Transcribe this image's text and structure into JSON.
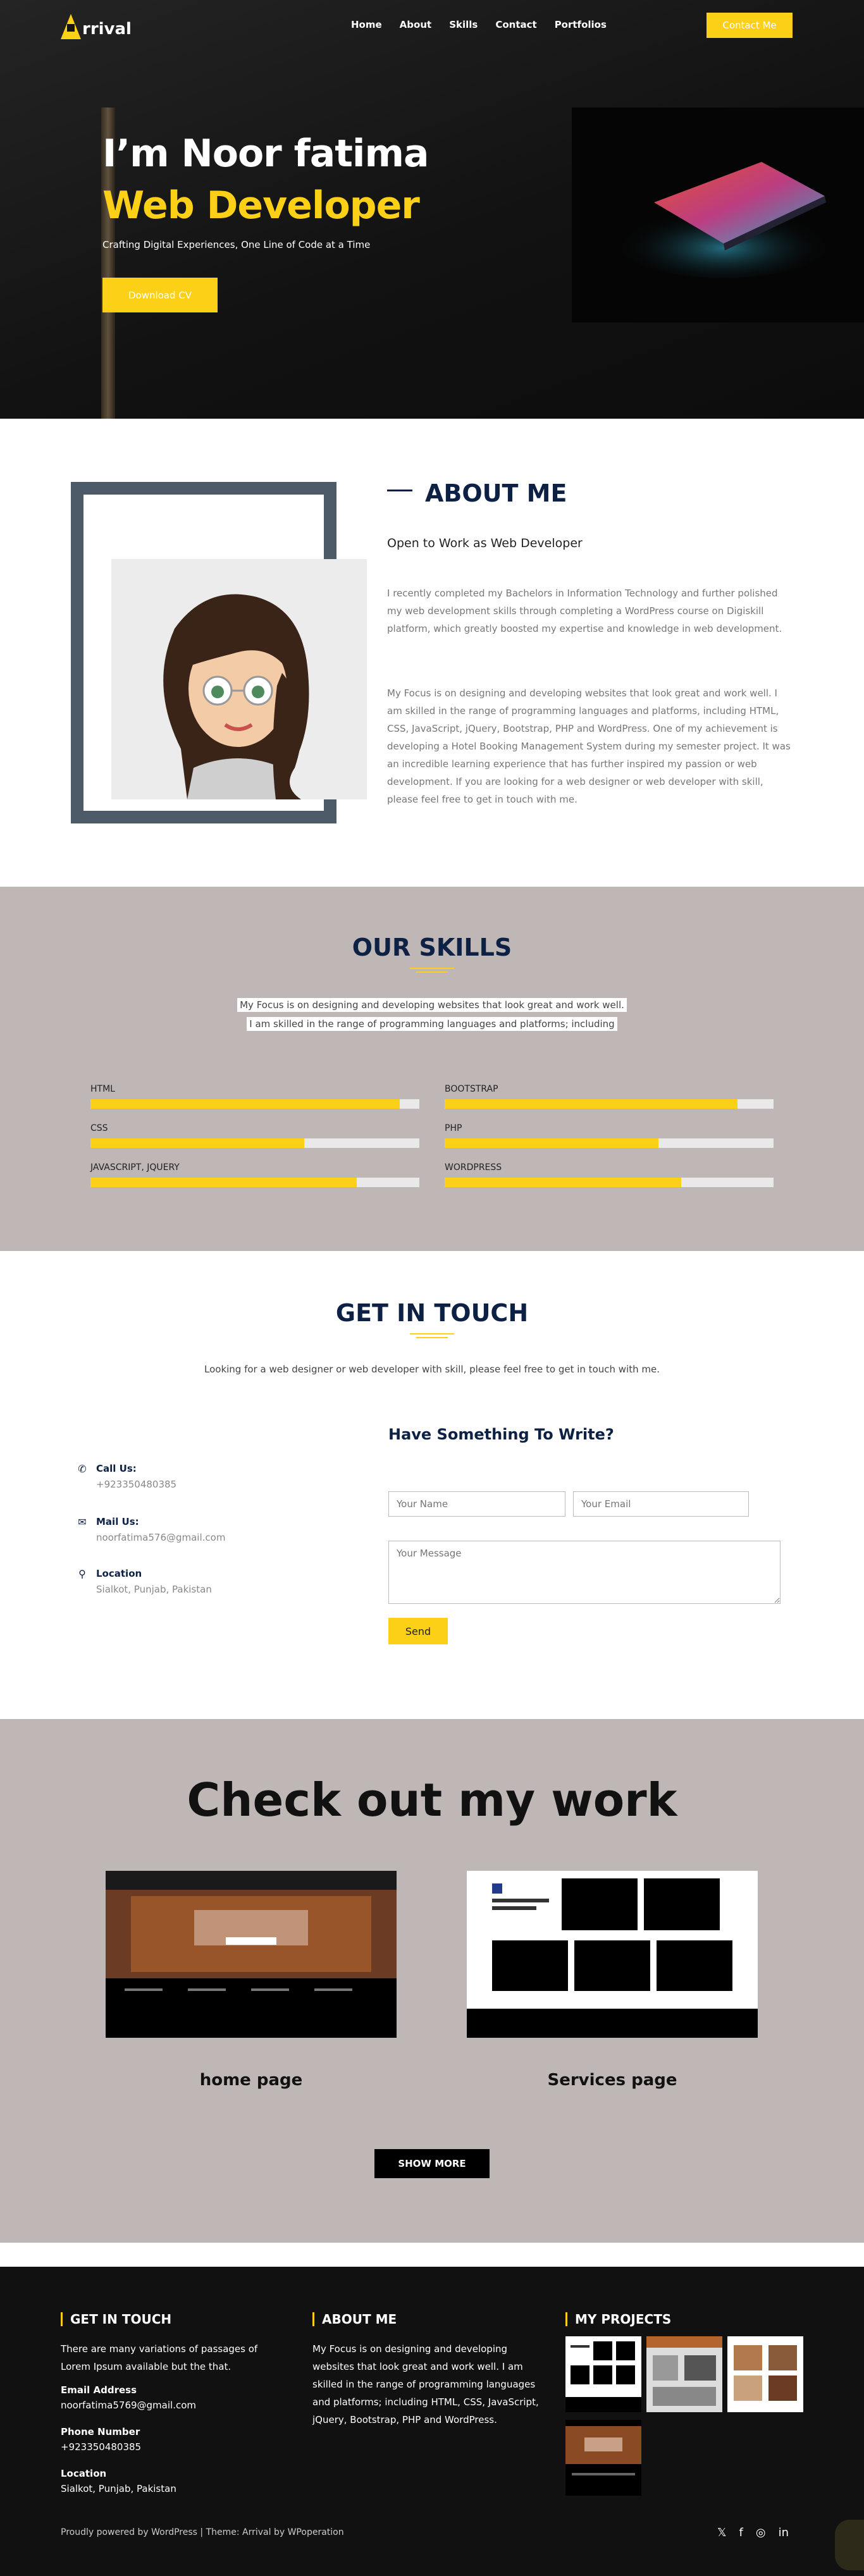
{
  "nav": {
    "logo_text": "rrival",
    "items": [
      "Home",
      "About",
      "Skills",
      "Contact",
      "Portfolios"
    ],
    "contact_button": "Contact Me"
  },
  "hero": {
    "title": "I’m Noor fatima",
    "subtitle": "Web Developer",
    "tagline": "Crafting Digital Experiences, One Line of Code at a Time",
    "cta": "Download CV"
  },
  "about": {
    "heading": "ABOUT ME",
    "open_to": "Open to Work as Web Developer",
    "p1": "I recently completed my Bachelors in Information Technology and further polished my web development skills through completing a WordPress course on Digiskill platform, which greatly boosted my expertise and knowledge in web development.",
    "p2": "My Focus is on designing and developing websites that look great and work well. I am skilled in the range of programming languages and platforms, including HTML, CSS, JavaScript, jQuery, Bootstrap, PHP and WordPress. One of my achievement is developing a Hotel Booking Management System during my semester project. It was an incredible learning experience that has further inspired my passion or web development. If you are looking for a web designer or web developer with skill, please feel free to get in touch with me."
  },
  "skills": {
    "heading": "OUR SKILLS",
    "intro1": "My Focus is on designing and developing websites that look great and work well.",
    "intro2": "I am skilled in the range of programming languages and platforms; including",
    "items": [
      {
        "label": "HTML",
        "level": 0.94
      },
      {
        "label": "BOOTSTRAP",
        "level": 0.89
      },
      {
        "label": "CSS",
        "level": 0.65
      },
      {
        "label": "PHP",
        "level": 0.65
      },
      {
        "label": "JAVASCRIPT, JQUERY",
        "level": 0.81
      },
      {
        "label": "WORDPRESS",
        "level": 0.72
      }
    ]
  },
  "contact": {
    "heading": "GET IN TOUCH",
    "description": "Looking for a web designer or web developer with skill, please feel free to get in touch with me.",
    "call_title": "Call Us:",
    "call_value": "+923350480385",
    "mail_title": "Mail Us:",
    "mail_value": "noorfatima576@gmail.com",
    "loc_title": "Location",
    "loc_value": "Sialkot, Punjab, Pakistan",
    "form_heading": "Have Something To Write?",
    "name_placeholder": "Your Name",
    "email_placeholder": "Your Email",
    "message_placeholder": "Your Message",
    "send": "Send"
  },
  "work": {
    "heading": "Check out my work",
    "projects": [
      {
        "caption": "home page"
      },
      {
        "caption": "Services page"
      }
    ],
    "more": "SHOW MORE"
  },
  "footer": {
    "col1_heading": "GET IN TOUCH",
    "col1_text": "There are many variations of passages of Lorem Ipsum available but the that.",
    "email_label": "Email Address",
    "email_value": "noorfatima5769@gmail.com",
    "phone_label": "Phone Number",
    "phone_value": "+923350480385",
    "location_label": "Location",
    "location_value": "Sialkot, Punjab, Pakistan",
    "col2_heading": "ABOUT ME",
    "col2_text": "My Focus is on designing and developing websites that look great and work well. I am skilled in the range of programming languages and platforms; including HTML, CSS, JavaScript, jQuery, Bootstrap, PHP and WordPress.",
    "col3_heading": "MY PROJECTS",
    "credits": "Proudly powered by WordPress | Theme: Arrival by WPoperation",
    "social": [
      "twitter-icon",
      "facebook-icon",
      "instagram-icon",
      "linkedin-icon"
    ]
  },
  "colors": {
    "accent": "#fbd017",
    "navy": "#0d2145",
    "panel": "#bfb6b6",
    "dark": "#111111"
  }
}
